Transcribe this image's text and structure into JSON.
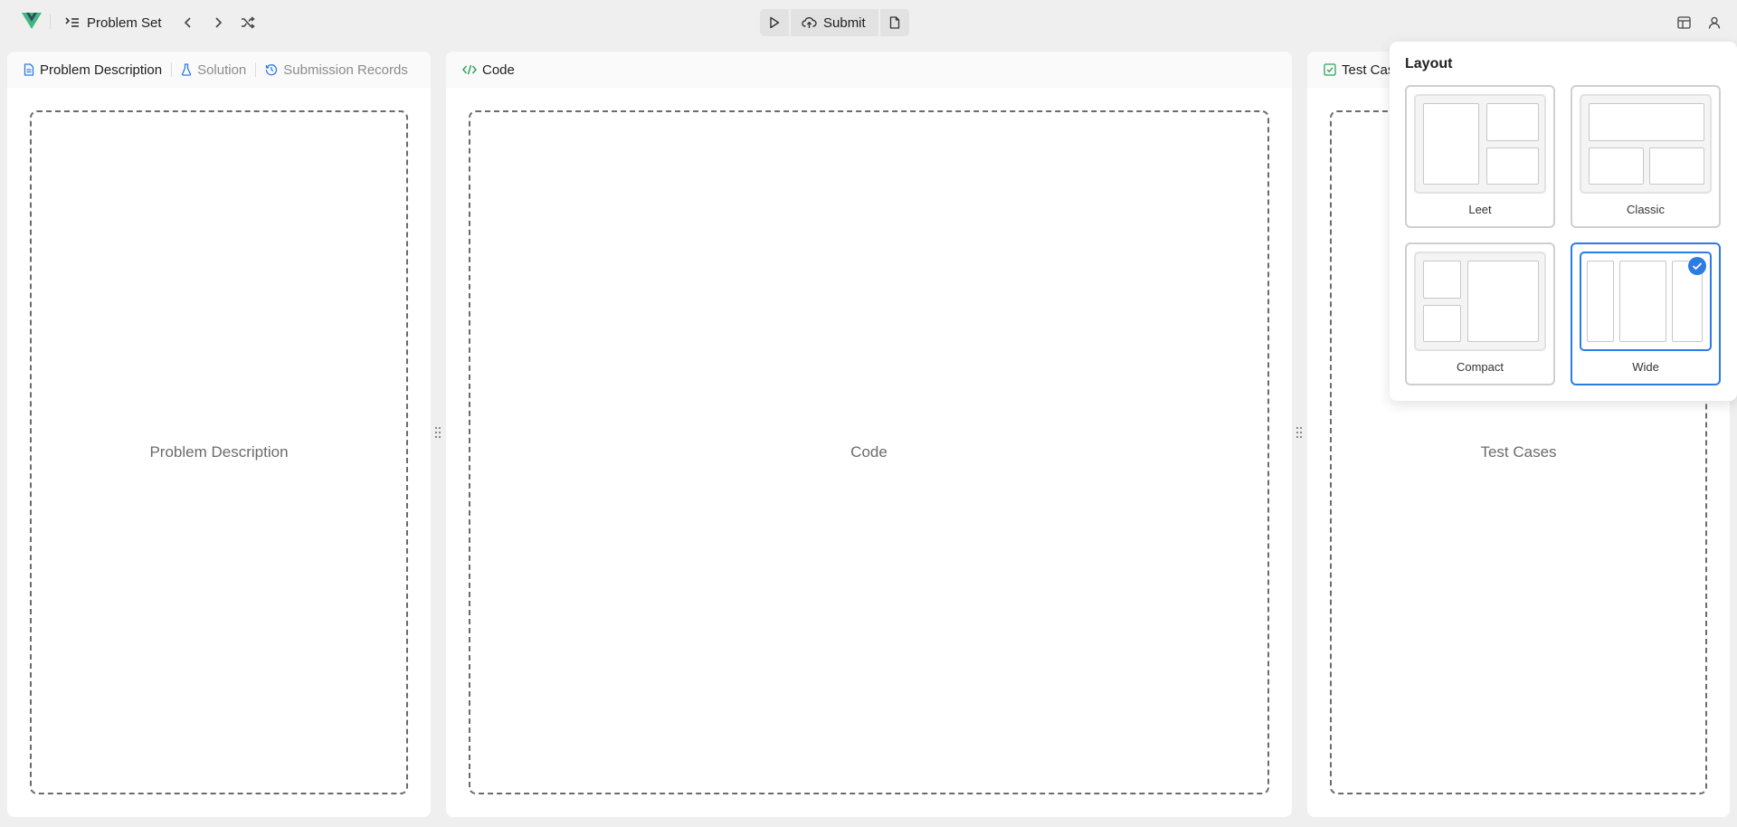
{
  "topbar": {
    "problem_set_label": "Problem Set",
    "submit_label": "Submit"
  },
  "left_panel": {
    "tabs": [
      {
        "label": "Problem Description",
        "state": "active"
      },
      {
        "label": "Solution",
        "state": "inactive"
      },
      {
        "label": "Submission Records",
        "state": "inactive"
      }
    ],
    "placeholder": "Problem Description"
  },
  "code_panel": {
    "tab_label": "Code",
    "placeholder": "Code"
  },
  "test_panel": {
    "tab_label": "Test Cas",
    "placeholder": "Test Cases"
  },
  "layout_popover": {
    "title": "Layout",
    "options": [
      {
        "label": "Leet",
        "selected": false
      },
      {
        "label": "Classic",
        "selected": false
      },
      {
        "label": "Compact",
        "selected": false
      },
      {
        "label": "Wide",
        "selected": true
      }
    ]
  },
  "colors": {
    "accent": "#2d7be5",
    "code_icon": "#2ba55b",
    "test_icon": "#2ba55b",
    "brand_green": "#41b883",
    "brand_dark": "#35495e"
  }
}
